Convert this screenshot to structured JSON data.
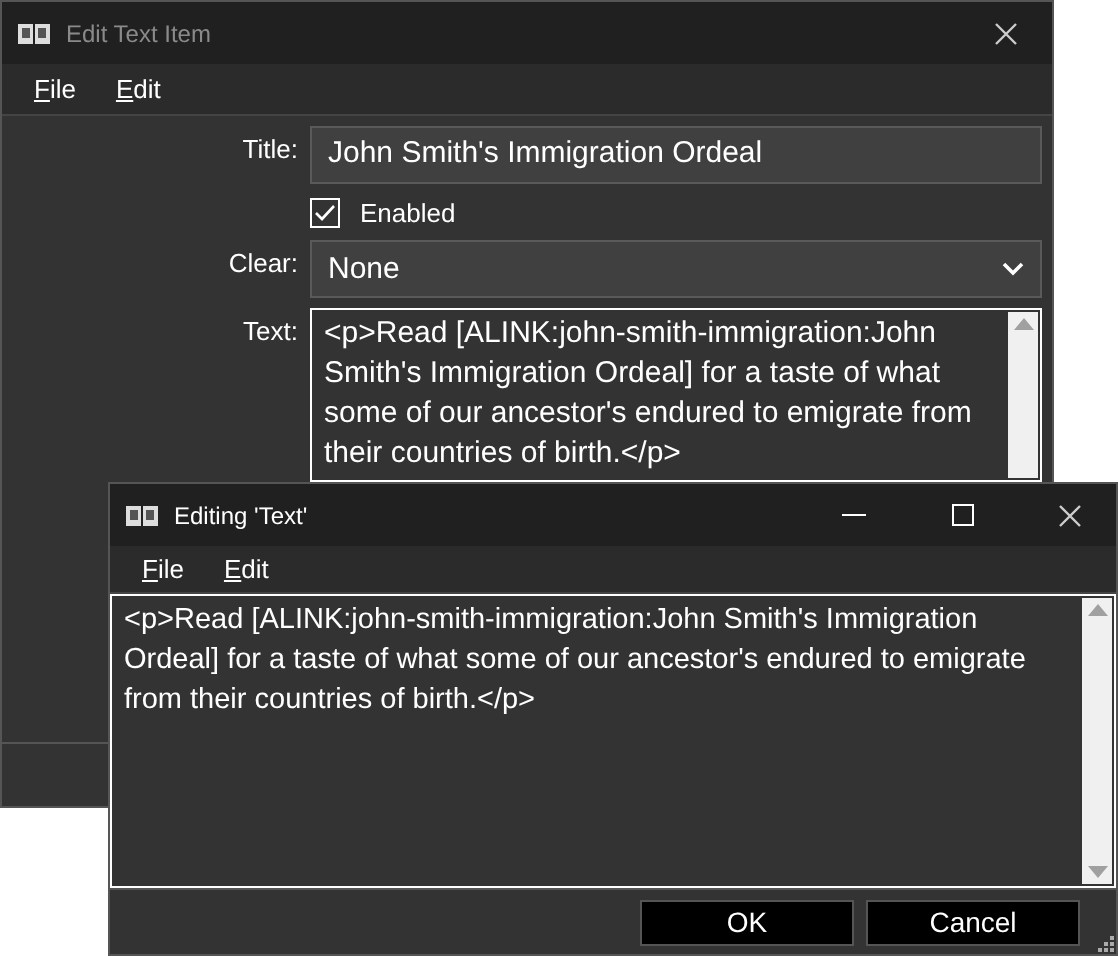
{
  "main_window": {
    "title": "Edit Text Item",
    "menu": [
      "File",
      "Edit"
    ],
    "fields": [
      {
        "kind": "text",
        "label": "Title:",
        "value": "John Smith's Immigration Ordeal"
      },
      {
        "kind": "checkbox",
        "label": "Enabled",
        "checked": true
      },
      {
        "kind": "select",
        "label": "Clear:",
        "value": "None"
      },
      {
        "kind": "textarea",
        "label": "Text:",
        "value": "<p>Read [ALINK:john-smith-immigration:John Smith's Immigration Ordeal] for a taste of what some of our ancestor's endured to emigrate from their countries of birth.</p>"
      }
    ]
  },
  "text_editor": {
    "title": "Editing 'Text'",
    "menu": [
      "File",
      "Edit"
    ],
    "value": "<p>Read [ALINK:john-smith-immigration:John Smith's Immigration Ordeal] for a taste of what some of our ancestor's endured to emigrate from their countries of birth.</p>",
    "buttons": [
      "OK",
      "Cancel"
    ]
  }
}
